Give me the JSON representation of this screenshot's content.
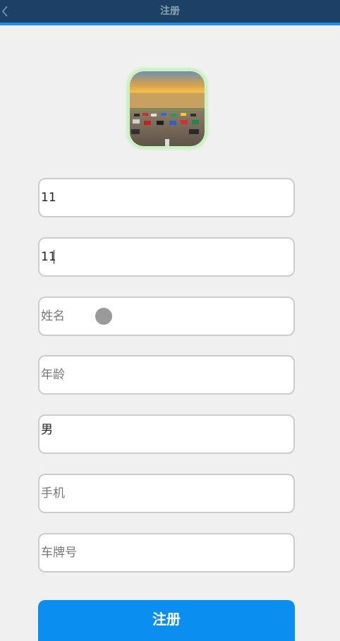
{
  "header": {
    "title": "注册",
    "back_icon": "chevron-left-icon",
    "bar_color": "#1c4164",
    "accent_color": "#1e90e6"
  },
  "form": {
    "username_value": "11",
    "password_value": "11",
    "name_placeholder": "姓名",
    "age_placeholder": "年龄",
    "gender_value": "男",
    "phone_placeholder": "手机",
    "plate_placeholder": "车牌号"
  },
  "submit": {
    "label": "注册",
    "color": "#0a8ff0"
  }
}
